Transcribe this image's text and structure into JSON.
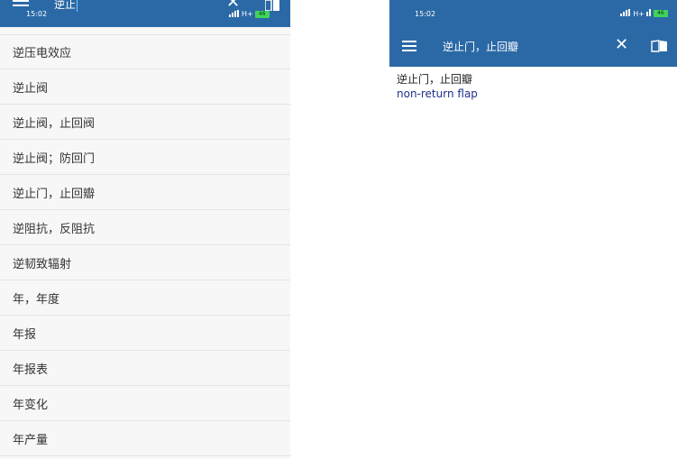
{
  "left": {
    "status": {
      "time": "15:02",
      "network": "H+",
      "battery": "46"
    },
    "search": {
      "query": "逆止"
    },
    "words": [
      "逆压电效应",
      "逆止阀",
      "逆止阀，止回阀",
      "逆止阀；防回门",
      "逆止门，止回瓣",
      "逆阻抗，反阻抗",
      "逆韧致辐射",
      "年，年度",
      "年报",
      "年报表",
      "年变化",
      "年产量"
    ]
  },
  "right": {
    "status": {
      "time": "15:02",
      "network": "H+",
      "battery": "46"
    },
    "search": {
      "query": "逆止门，止回瓣"
    },
    "entry": {
      "headword": "逆止门，止回瓣",
      "translation": "non-return flap"
    }
  },
  "colors": {
    "toolbar": "#2b69a6",
    "translation": "#1e2f8a",
    "battery": "#3fd45b"
  },
  "icons": {
    "menu": "menu-icon",
    "close": "close-icon",
    "book": "book-icon"
  }
}
